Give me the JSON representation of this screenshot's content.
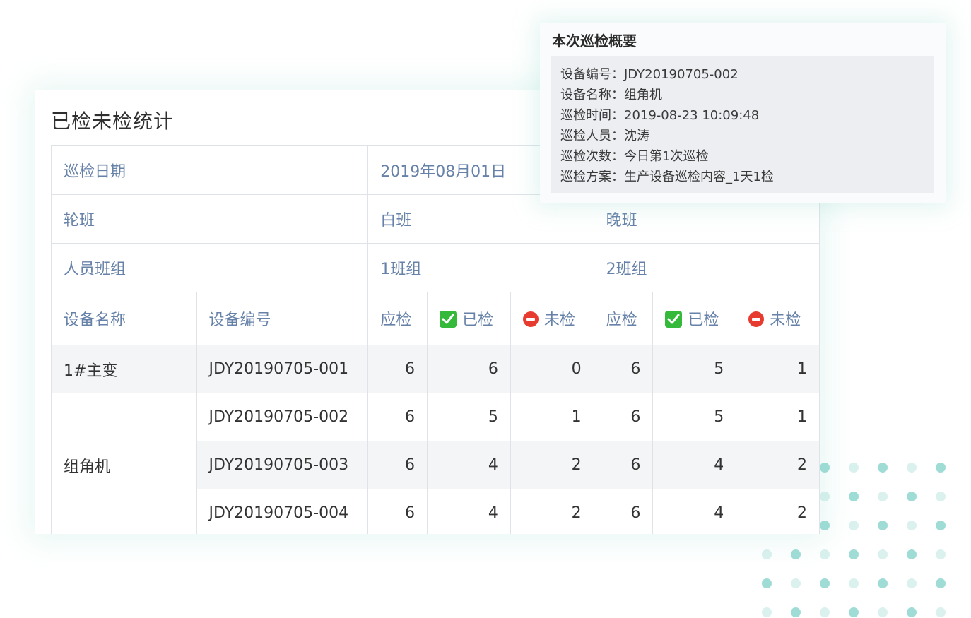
{
  "card": {
    "title": "已检未检统计",
    "header_rows": [
      {
        "label": "巡检日期",
        "value": "2019年08月01日"
      },
      {
        "label": "轮班",
        "shift1": "白班",
        "shift2": "晚班"
      },
      {
        "label": "人员班组",
        "group1": "1班组",
        "group2": "2班组"
      }
    ],
    "columns": {
      "device_name": "设备名称",
      "device_code": "设备编号",
      "shift1": {
        "due": "应检",
        "done": "已检",
        "undone": "未检"
      },
      "shift2": {
        "due": "应检",
        "done": "已检",
        "undone": "未检"
      }
    },
    "rows": [
      {
        "name": "1#主变",
        "code": "JDY20190705-001",
        "s1_due": "6",
        "s1_done": "6",
        "s1_undone": "0",
        "s2_due": "6",
        "s2_done": "5",
        "s2_undone": "1"
      },
      {
        "name": "组角机",
        "code": "JDY20190705-002",
        "s1_due": "6",
        "s1_done": "5",
        "s1_undone": "1",
        "s2_due": "6",
        "s2_done": "5",
        "s2_undone": "1"
      },
      {
        "code": "JDY20190705-003",
        "s1_due": "6",
        "s1_done": "4",
        "s1_undone": "2",
        "s2_due": "6",
        "s2_done": "4",
        "s2_undone": "2"
      },
      {
        "code": "JDY20190705-004",
        "s1_due": "6",
        "s1_done": "4",
        "s1_undone": "2",
        "s2_due": "6",
        "s2_done": "4",
        "s2_undone": "2"
      }
    ],
    "icons": {
      "done": "check-mark-icon",
      "undone": "no-entry-icon"
    }
  },
  "popup": {
    "title": "本次巡检概要",
    "lines": [
      "设备编号：JDY20190705-002",
      "设备名称：组角机",
      "巡检时间：2019-08-23 10:09:48",
      "巡检人员：沈涛",
      "巡检次数：今日第1次巡检",
      "巡检方案：生产设备巡检内容_1天1检"
    ]
  },
  "colors": {
    "header_text": "#6782a8",
    "accent_dots": "#9fdcd6",
    "check_green": "#35b93a",
    "no_entry_red": "#e63b2e"
  }
}
